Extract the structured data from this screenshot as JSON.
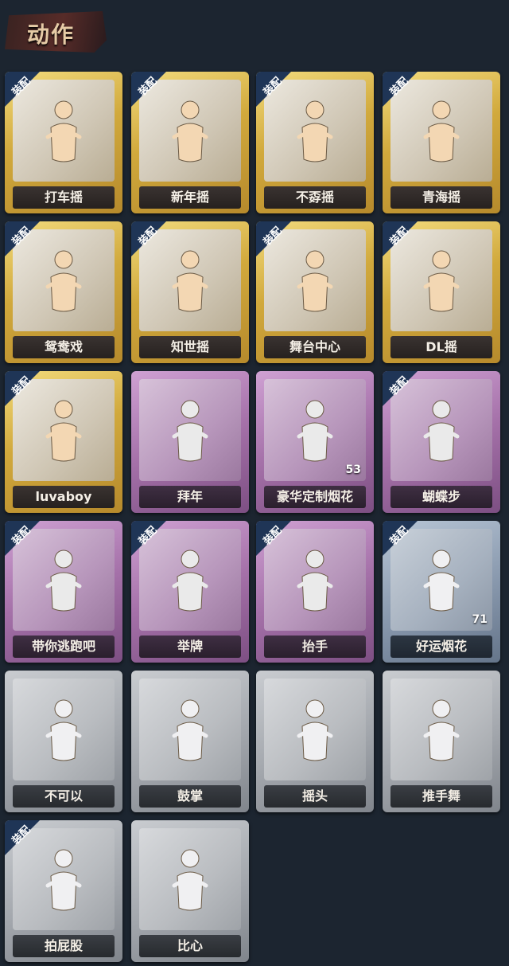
{
  "header": {
    "title": "动作"
  },
  "equip_badge": "装配",
  "cards": [
    {
      "label": "打车摇",
      "tier": "gold",
      "equipped": true,
      "icon": "dance-figure-icon"
    },
    {
      "label": "新年摇",
      "tier": "gold",
      "equipped": true,
      "icon": "dance-figure-icon"
    },
    {
      "label": "不孬摇",
      "tier": "gold",
      "equipped": true,
      "icon": "dance-figure-icon"
    },
    {
      "label": "青海摇",
      "tier": "gold",
      "equipped": true,
      "icon": "dance-figure-icon"
    },
    {
      "label": "鸳鸯戏",
      "tier": "gold",
      "equipped": true,
      "icon": "dance-figure-icon"
    },
    {
      "label": "知世摇",
      "tier": "gold",
      "equipped": true,
      "icon": "dance-figure-icon"
    },
    {
      "label": "舞台中心",
      "tier": "gold",
      "equipped": true,
      "icon": "dance-figure-icon"
    },
    {
      "label": "DL摇",
      "tier": "gold",
      "equipped": true,
      "icon": "dance-figure-icon"
    },
    {
      "label": "luvaboy",
      "tier": "gold",
      "equipped": true,
      "icon": "dance-figure-icon"
    },
    {
      "label": "拜年",
      "tier": "purple",
      "equipped": false,
      "icon": "bow-figure-icon"
    },
    {
      "label": "豪华定制烟花",
      "tier": "purple",
      "equipped": false,
      "icon": "fireworks-box-icon",
      "count": "53"
    },
    {
      "label": "蝴蝶步",
      "tier": "purple",
      "equipped": true,
      "icon": "dance-figure-icon"
    },
    {
      "label": "带你逃跑吧",
      "tier": "purple",
      "equipped": true,
      "icon": "dance-figure-icon"
    },
    {
      "label": "举牌",
      "tier": "purple",
      "equipped": true,
      "icon": "sign-figure-icon"
    },
    {
      "label": "抬手",
      "tier": "purple",
      "equipped": true,
      "icon": "raise-hand-figure-icon"
    },
    {
      "label": "好运烟花",
      "tier": "blue",
      "equipped": true,
      "icon": "firework-can-icon",
      "count": "71"
    },
    {
      "label": "不可以",
      "tier": "gray",
      "equipped": false,
      "icon": "finger-wag-icon"
    },
    {
      "label": "鼓掌",
      "tier": "gray",
      "equipped": false,
      "icon": "clap-hands-icon"
    },
    {
      "label": "摇头",
      "tier": "gray",
      "equipped": false,
      "icon": "head-shake-figure-icon"
    },
    {
      "label": "推手舞",
      "tier": "gray",
      "equipped": false,
      "icon": "push-dance-figure-icon"
    },
    {
      "label": "拍屁股",
      "tier": "gray",
      "equipped": true,
      "icon": "slap-figure-icon"
    },
    {
      "label": "比心",
      "tier": "gray",
      "equipped": false,
      "icon": "heart-hand-figure-icon"
    }
  ]
}
